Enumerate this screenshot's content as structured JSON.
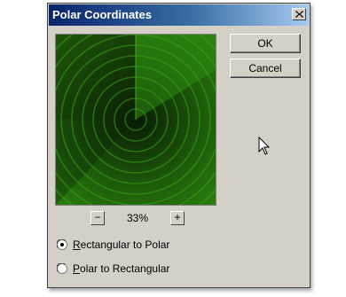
{
  "dialog": {
    "title": "Polar Coordinates",
    "close_label": "×",
    "buttons": {
      "ok_label": "OK",
      "cancel_label": "Cancel"
    },
    "zoom": {
      "minus_label": "−",
      "plus_label": "+",
      "value": "33%"
    },
    "options": [
      {
        "accesskey": "R",
        "rest": "ectangular to Polar",
        "selected": true
      },
      {
        "accesskey": "P",
        "rest": "olar to Rectangular",
        "selected": false
      }
    ]
  },
  "colors": {
    "title_bar_start": "#0a246a",
    "title_bar_end": "#a6caf0",
    "dialog_face": "#d4d0c8",
    "preview_green": "#2f8a12"
  },
  "icons": {
    "close": "close-icon",
    "cursor": "mouse-pointer-icon",
    "radio_selected": "radio-selected-icon",
    "radio_unselected": "radio-unselected-icon"
  }
}
